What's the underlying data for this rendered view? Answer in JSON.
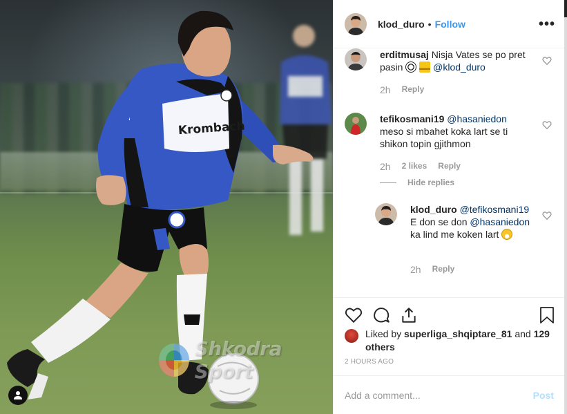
{
  "post": {
    "author": "klod_duro",
    "follow_label": "Follow",
    "more_label": "•••",
    "dot": "•"
  },
  "photo": {
    "watermark_text": "Shkodra Sport",
    "jersey_sponsor": "Krombach"
  },
  "comments": [
    {
      "user": "erditmusaj",
      "text": "Nisja Vates se po pret pasin",
      "mention": "@klod_duro",
      "time": "2h",
      "reply_label": "Reply"
    },
    {
      "user": "tefikosmani19",
      "mention": "@hasaniedon",
      "text": "meso si mbahet koka lart se ti shikon topin gjithmon",
      "time": "2h",
      "likes": "2 likes",
      "reply_label": "Reply"
    }
  ],
  "hide_replies_label": "Hide replies",
  "reply": {
    "user": "klod_duro",
    "mention1": "@tefikosmani19",
    "text1": "E don se don",
    "mention2": "@hasaniedon",
    "text2": "ka lind me koken lart",
    "time": "2h",
    "reply_label": "Reply"
  },
  "likes": {
    "prefix": "Liked by",
    "user": "superliga_shqiptare_81",
    "and": "and",
    "others": "129 others"
  },
  "posted_time": "2 HOURS AGO",
  "add_comment": {
    "placeholder": "Add a comment...",
    "post_label": "Post"
  },
  "colors": {
    "link_blue": "#3897f0",
    "mention": "#003569",
    "muted": "#999999",
    "post_disabled": "#b2dffc",
    "jersey_blue": "#3b5fc8"
  }
}
